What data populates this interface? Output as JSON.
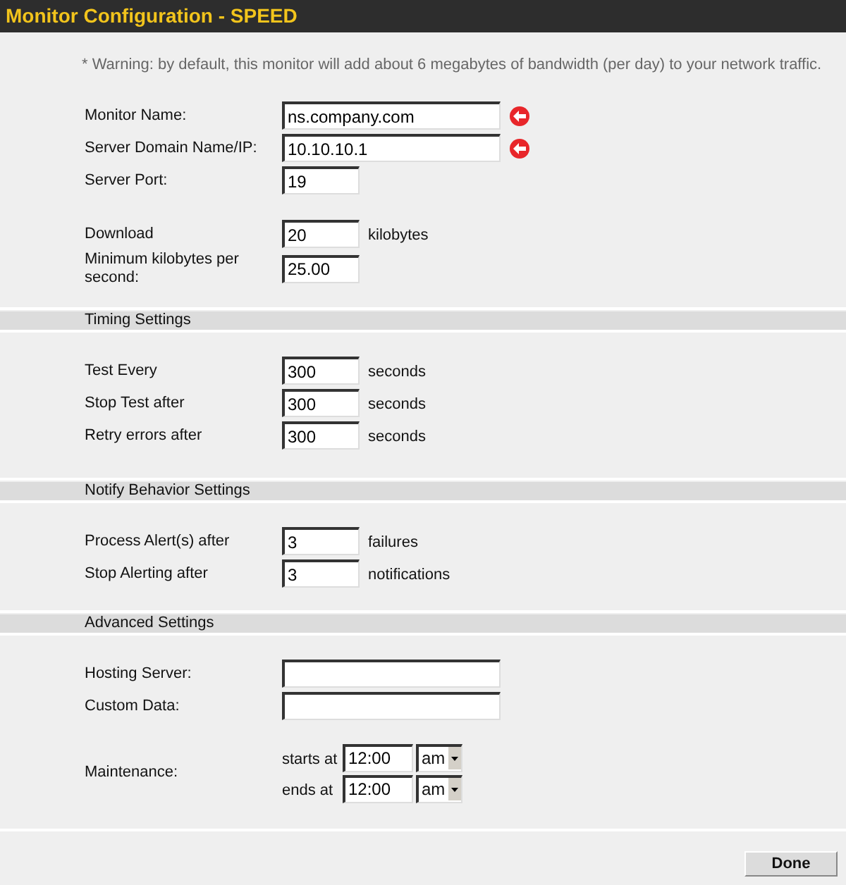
{
  "window": {
    "title": "Monitor Configuration - SPEED"
  },
  "warning": "* Warning: by default, this monitor will add about 6 megabytes of bandwidth (per day) to your network traffic.",
  "sections": [
    {
      "rows": [
        {
          "kind": "text",
          "label": "Monitor Name:",
          "value": "ns.company.com",
          "wide": true,
          "required": true
        },
        {
          "kind": "text",
          "label": "Server Domain Name/IP:",
          "value": "10.10.10.1",
          "wide": true,
          "required": true
        },
        {
          "kind": "text",
          "label": "Server Port:",
          "value": "19",
          "wide": false,
          "required": false
        },
        {
          "kind": "gap"
        },
        {
          "kind": "text",
          "label": "Download",
          "value": "20",
          "wide": false,
          "unit": "kilobytes",
          "required": false
        },
        {
          "kind": "text",
          "label": "Minimum kilobytes per second:",
          "value": "25.00",
          "wide": false,
          "required": false
        }
      ]
    },
    {
      "header": "Timing Settings",
      "rows": [
        {
          "kind": "text",
          "label": "Test Every",
          "value": "300",
          "wide": false,
          "unit": "seconds",
          "required": false
        },
        {
          "kind": "text",
          "label": "Stop Test after",
          "value": "300",
          "wide": false,
          "unit": "seconds",
          "required": false
        },
        {
          "kind": "text",
          "label": "Retry errors after",
          "value": "300",
          "wide": false,
          "unit": "seconds",
          "required": false
        }
      ]
    },
    {
      "header": "Notify Behavior Settings",
      "rows": [
        {
          "kind": "text",
          "label": "Process Alert(s) after",
          "value": "3",
          "wide": false,
          "unit": "failures",
          "required": false
        },
        {
          "kind": "text",
          "label": "Stop Alerting after",
          "value": "3",
          "wide": false,
          "unit": "notifications",
          "required": false
        }
      ]
    },
    {
      "header": "Advanced Settings",
      "rows": [
        {
          "kind": "text",
          "label": "Hosting Server:",
          "wide": true,
          "required": false
        },
        {
          "kind": "text",
          "label": "Custom Data:",
          "wide": true,
          "required": false
        },
        {
          "kind": "gap"
        },
        {
          "kind": "maintenance",
          "label": "Maintenance:",
          "times": [
            {
              "label": "starts at",
              "time": "12:00",
              "period": "am"
            },
            {
              "label": "ends at",
              "time": "12:00",
              "period": "am"
            }
          ]
        }
      ]
    }
  ],
  "buttons": [
    {
      "label": "Done"
    }
  ]
}
